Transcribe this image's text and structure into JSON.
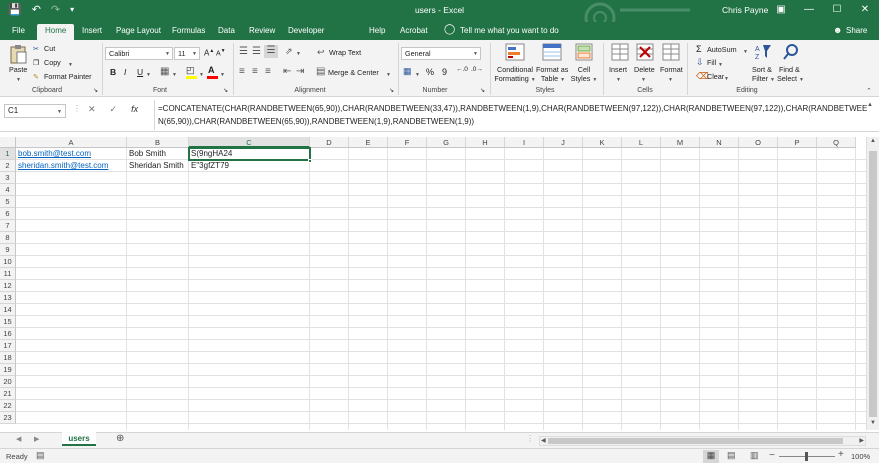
{
  "window": {
    "title": "users  -  Excel",
    "user": "Chris Payne"
  },
  "tabs": [
    "File",
    "Home",
    "Insert",
    "Page Layout",
    "Formulas",
    "Data",
    "Review",
    "Developer",
    "Help",
    "Acrobat"
  ],
  "active_tab": "Home",
  "tell_me": "Tell me what you want to do",
  "share": "Share",
  "ribbon": {
    "clipboard": {
      "label": "Clipboard",
      "paste": "Paste",
      "cut": "Cut",
      "copy": "Copy",
      "format_painter": "Format Painter"
    },
    "font": {
      "label": "Font",
      "name": "Calibri",
      "size": "11",
      "bold": "B",
      "italic": "I",
      "underline": "U"
    },
    "alignment": {
      "label": "Alignment",
      "wrap": "Wrap Text",
      "merge": "Merge & Center"
    },
    "number": {
      "label": "Number",
      "format": "General",
      "percent": "%",
      "comma": "9"
    },
    "styles": {
      "label": "Styles",
      "conditional_1": "Conditional",
      "conditional_2": "Formatting",
      "format_as_1": "Format as",
      "format_as_2": "Table",
      "cell_1": "Cell",
      "cell_2": "Styles"
    },
    "cells": {
      "label": "Cells",
      "insert": "Insert",
      "delete": "Delete",
      "format": "Format"
    },
    "editing": {
      "label": "Editing",
      "autosum": "AutoSum",
      "fill": "Fill",
      "clear": "Clear",
      "sort_1": "Sort &",
      "sort_2": "Filter",
      "find_1": "Find &",
      "find_2": "Select"
    }
  },
  "formula_bar": {
    "name_box": "C1",
    "formula": "=CONCATENATE(CHAR(RANDBETWEEN(65,90)),CHAR(RANDBETWEEN(33,47)),RANDBETWEEN(1,9),CHAR(RANDBETWEEN(97,122)),CHAR(RANDBETWEEN(97,122)),CHAR(RANDBETWEEN(65,90)),CHAR(RANDBETWEEN(65,90)),RANDBETWEEN(1,9),RANDBETWEEN(1,9))"
  },
  "columns": [
    "A",
    "B",
    "C",
    "D",
    "E",
    "F",
    "G",
    "H",
    "I",
    "J",
    "K",
    "L",
    "M",
    "N",
    "O",
    "P",
    "Q"
  ],
  "rows": [
    "1",
    "2",
    "3",
    "4",
    "5",
    "6",
    "7",
    "8",
    "9",
    "10",
    "11",
    "12",
    "13",
    "14",
    "15",
    "16",
    "17",
    "18",
    "19",
    "20",
    "21",
    "22",
    "23"
  ],
  "cells": {
    "r1": {
      "a": "bob.smith@test.com",
      "b": "Bob Smith",
      "c": "S(9ngHA24"
    },
    "r2": {
      "a": "sheridan.smith@test.com",
      "b": "Sheridan Smith",
      "c": "E\"3gfZT79"
    }
  },
  "sheet_tab": "users",
  "status": {
    "ready": "Ready",
    "zoom": "100%"
  }
}
